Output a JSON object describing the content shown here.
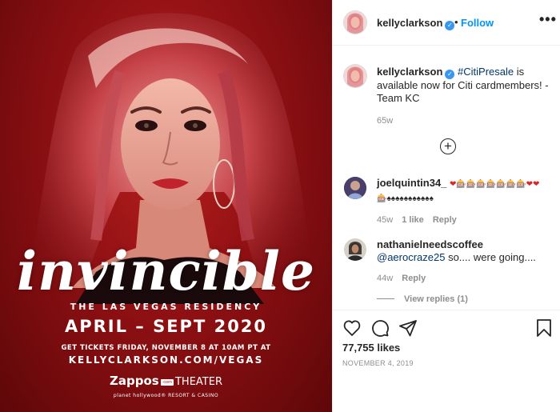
{
  "colors": {
    "accent": "#0095f6",
    "verified": "#3897f0",
    "muted": "#8e8e8e",
    "hashtag": "#00376b",
    "poster_red": "#9b1316"
  },
  "poster": {
    "title": "invincible",
    "subtitle": "THE LAS VEGAS RESIDENCY",
    "dates": "APRIL – SEPT 2020",
    "tickets_line": "GET TICKETS FRIDAY, NOVEMBER 8 AT 10AM PT AT",
    "url": "KELLYCLARKSON.COM/VEGAS",
    "venue_brand": "Zappos",
    "venue_badge": "·com",
    "venue_word": "THEATER",
    "resort": "planet hollywood® RESORT & CASINO"
  },
  "header": {
    "username": "kellyclarkson",
    "verified_icon": "check-icon",
    "separator": "•",
    "follow_label": "Follow",
    "more_label": "•••"
  },
  "caption": {
    "username": "kellyclarkson",
    "hashtag": "#CitiPresale",
    "text": " is available now for Citi cardmembers! - Team KC",
    "time": "65w"
  },
  "load_more_label": "+",
  "comments": [
    {
      "username": "joelquintin34_",
      "text_emoji_row1": "❤🎰🎰🎰🎰🎰🎰🎰❤❤",
      "text_emoji_row2": "🎰♠♠♠♠♠♠♠♠♠♠♠",
      "time": "45w",
      "likes": "1 like",
      "reply": "Reply"
    },
    {
      "username": "nathanielneedscoffee",
      "mention": "@aerocraze25",
      "text": " so.... were going....",
      "time": "44w",
      "reply": "Reply",
      "view_replies": "View replies (1)"
    }
  ],
  "actions": {
    "like_icon": "heart-icon",
    "comment_icon": "comment-icon",
    "share_icon": "send-icon",
    "save_icon": "bookmark-icon"
  },
  "likes_count": "77,755 likes",
  "post_date": "NOVEMBER 4, 2019"
}
